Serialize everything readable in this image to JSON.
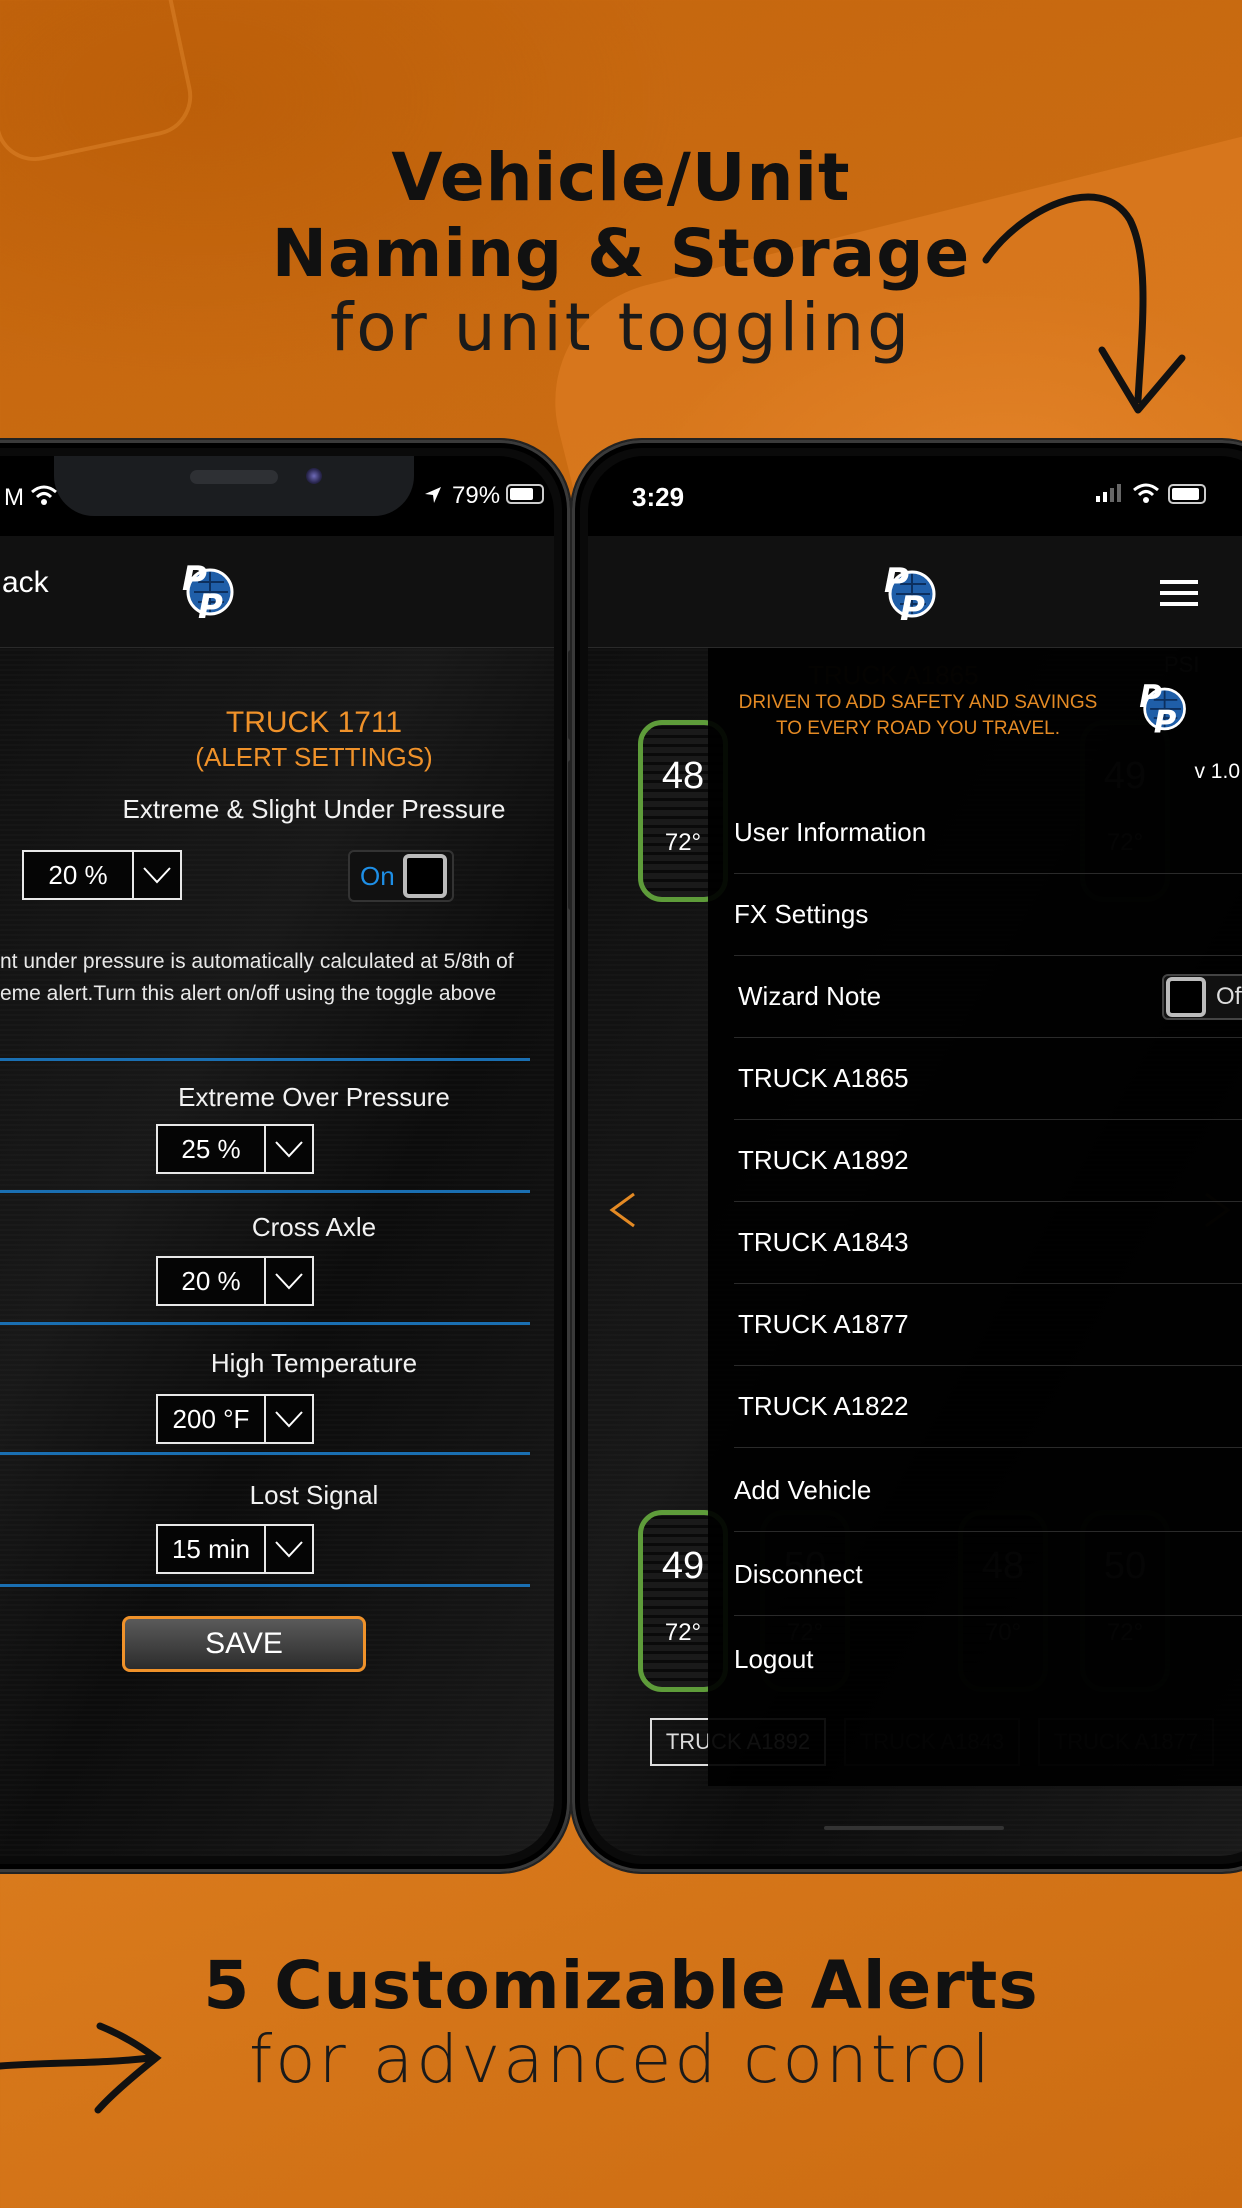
{
  "headlines": {
    "top": {
      "line1": "Vehicle/Unit",
      "line2": "Naming & Storage",
      "line3": "for unit toggling"
    },
    "bottom": {
      "line1": "5 Customizable Alerts",
      "line2": "for advanced control"
    }
  },
  "colors": {
    "background": "#cf7116",
    "accent_orange": "#f0922a",
    "divider_blue": "#1a6fb2",
    "tire_green": "#5e9c3a",
    "toggle_on_text": "#1e8fe6"
  },
  "left_phone": {
    "status": {
      "time_fragment": "M",
      "battery": "79%"
    },
    "nav": {
      "back_label": "ack"
    },
    "title": "TRUCK 1711",
    "subtitle": "(ALERT SETTINGS)",
    "alerts": [
      {
        "label": "Extreme & Slight Under Pressure",
        "value": "20 %",
        "toggle": "On"
      },
      {
        "label": "Extreme Over Pressure",
        "value": "25 %"
      },
      {
        "label": "Cross Axle",
        "value": "20 %"
      },
      {
        "label": "High Temperature",
        "value": "200 °F"
      },
      {
        "label": "Lost Signal",
        "value": "15 min"
      }
    ],
    "note_line1": "nt under pressure is automatically calculated at 5/8th of",
    "note_line2": "eme alert.Turn this alert on/off using the toggle above",
    "save_label": "SAVE"
  },
  "right_phone": {
    "status": {
      "time": "3:29"
    },
    "background": {
      "truck_title": "TRUCK A1865",
      "unit": "PSI",
      "tires_top": [
        {
          "psi": "48",
          "temp": "72°"
        },
        {
          "psi": "49",
          "temp": "72°"
        }
      ],
      "tires_bottom": [
        {
          "psi": "49",
          "temp": "72°"
        },
        {
          "psi": "50",
          "temp": "72°"
        },
        {
          "psi": "48",
          "temp": "70°"
        },
        {
          "psi": "50",
          "temp": "72°"
        }
      ],
      "truck_tabs": [
        "TRUCK A1892",
        "TRUCK A1843",
        "TRUCK A1877"
      ]
    },
    "drawer": {
      "tagline_line1": "DRIVEN TO ADD SAFETY AND SAVINGS",
      "tagline_line2": "TO EVERY ROAD YOU TRAVEL.",
      "version": "v 1.0",
      "items": [
        {
          "label": "User Information"
        },
        {
          "label": "FX Settings"
        },
        {
          "label": "Wizard Note",
          "toggle": "Off"
        },
        {
          "label": "TRUCK A1865"
        },
        {
          "label": "TRUCK A1892"
        },
        {
          "label": "TRUCK A1843"
        },
        {
          "label": "TRUCK A1877"
        },
        {
          "label": "TRUCK A1822"
        },
        {
          "label": "Add Vehicle"
        },
        {
          "label": "Disconnect"
        },
        {
          "label": "Logout"
        }
      ]
    }
  }
}
